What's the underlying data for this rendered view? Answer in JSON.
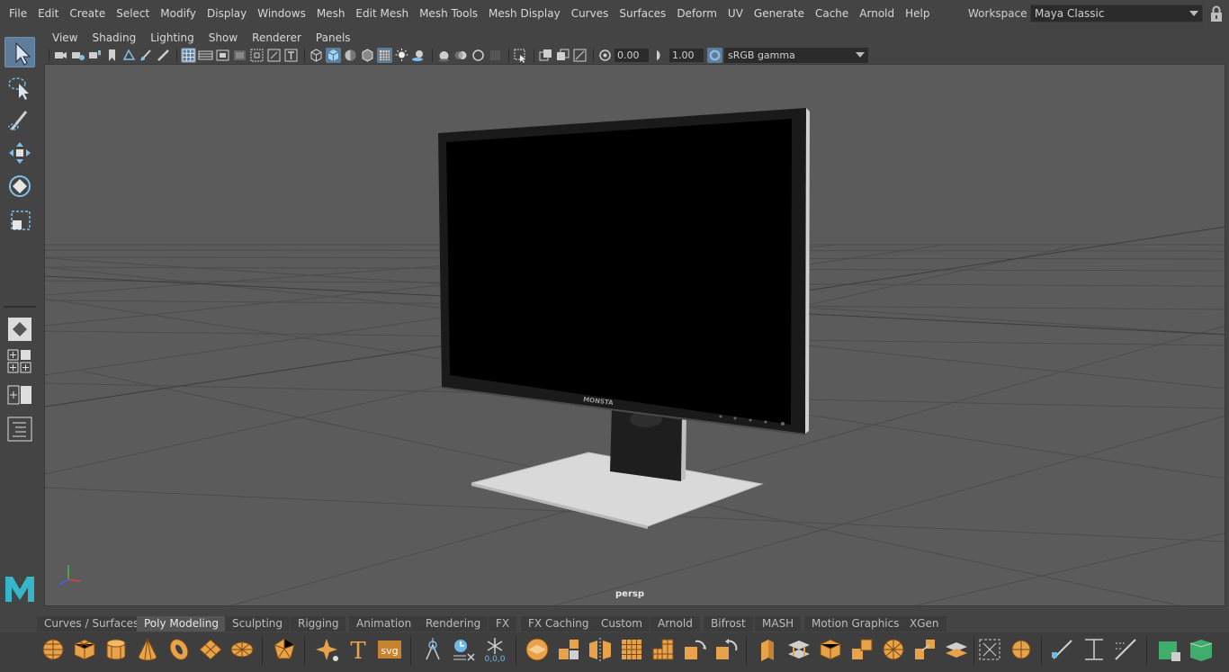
{
  "menubar": {
    "items": [
      "File",
      "Edit",
      "Create",
      "Select",
      "Modify",
      "Display",
      "Windows",
      "Mesh",
      "Edit Mesh",
      "Mesh Tools",
      "Mesh Display",
      "Curves",
      "Surfaces",
      "Deform",
      "UV",
      "Generate",
      "Cache",
      "Arnold",
      "Help"
    ],
    "workspace_label": "Workspace :",
    "workspace_value": "Maya Classic"
  },
  "panel": {
    "menus": [
      "View",
      "Shading",
      "Lighting",
      "Show",
      "Renderer",
      "Panels"
    ],
    "exposure": "0.00",
    "gamma": "1.00",
    "color_space": "sRGB gamma",
    "camera": "persp"
  },
  "viewport": {
    "object_text": "MONSTA"
  },
  "shelf": {
    "tabs": [
      "Curves / Surfaces",
      "Poly Modeling",
      "Sculpting",
      "Rigging",
      "Animation",
      "Rendering",
      "FX",
      "FX Caching",
      "Custom",
      "Arnold",
      "Bifrost",
      "MASH",
      "Motion Graphics",
      "XGen"
    ],
    "active_tab": "Poly Modeling",
    "svg_label": "svg",
    "text_label": "T",
    "coord_label": "0,0,0"
  },
  "colors": {
    "accent": "#5d7d9a",
    "shelf_icon": "#e8a24a",
    "background": "#444444",
    "viewport": "#5b5b5b"
  }
}
